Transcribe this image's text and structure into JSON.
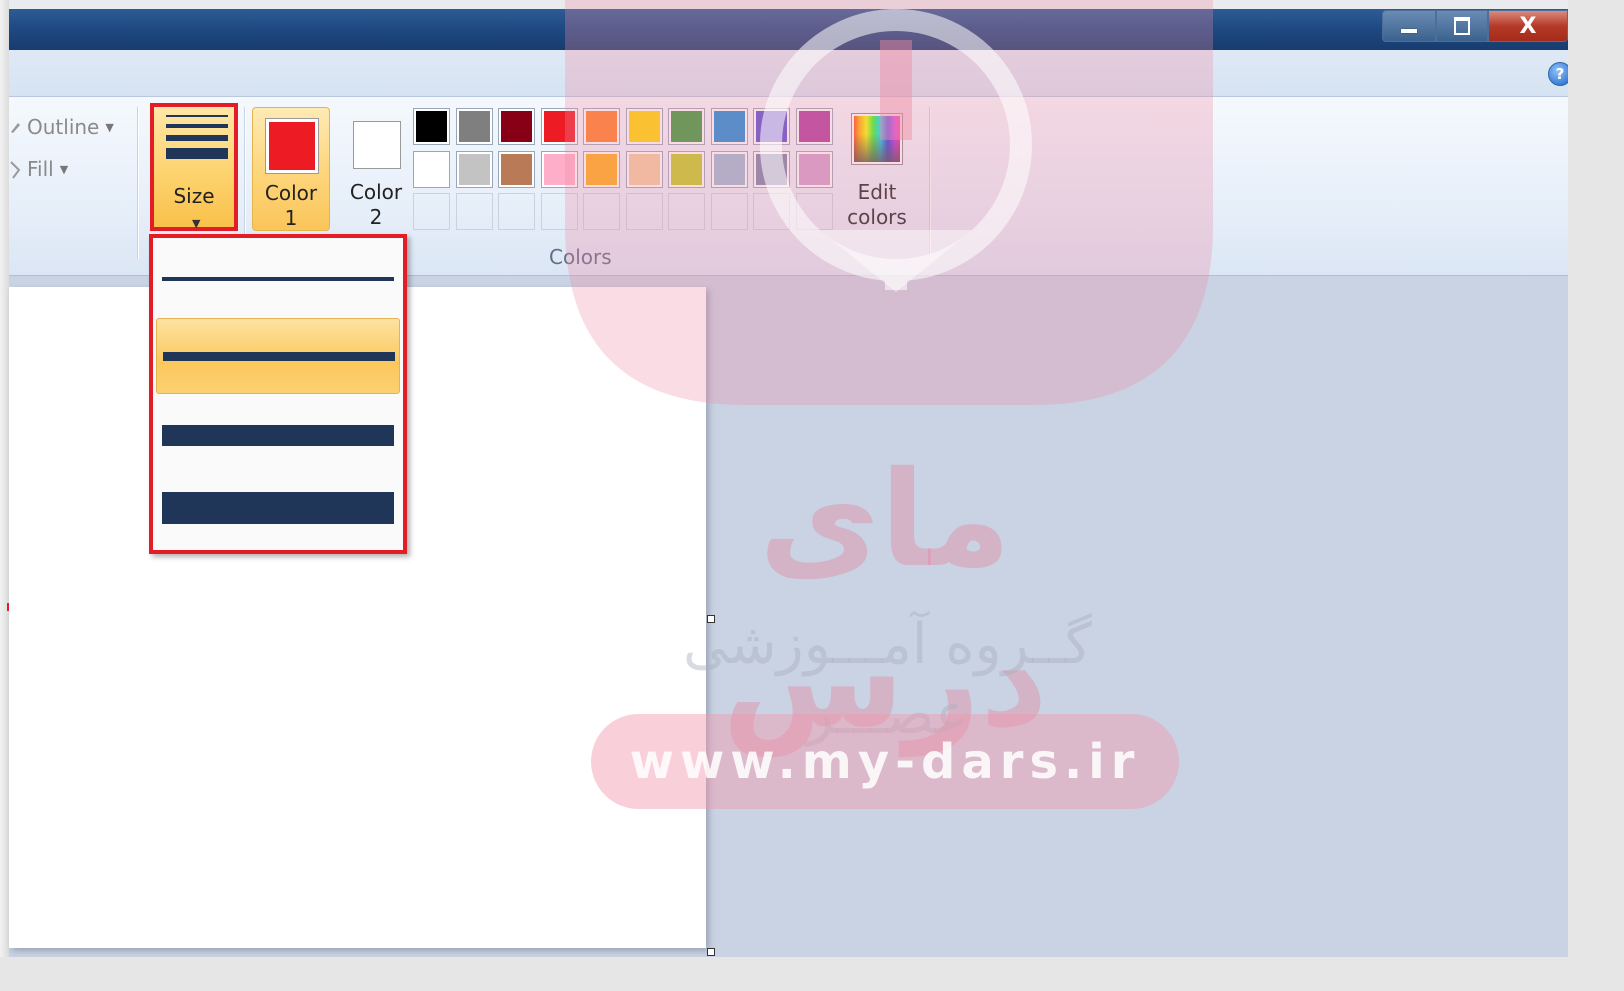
{
  "ribbon": {
    "shapes": {
      "outline_label": "Outline",
      "fill_label": "Fill"
    },
    "size_button_label": "Size",
    "color1": {
      "label_line1": "Color",
      "label_line2": "1",
      "color": "#ed1c24"
    },
    "color2": {
      "label_line1": "Color",
      "label_line2": "2",
      "color": "#ffffff"
    },
    "colors_group_label": "Colors",
    "palette_row1": [
      "#000000",
      "#7f7f7f",
      "#880015",
      "#ed1c24",
      "#ff7f27",
      "#ffd800",
      "#3c9b3c",
      "#1f8fd8",
      "#5b4fd1",
      "#b03ea0"
    ],
    "palette_row2": [
      "#ffffff",
      "#c3c3c3",
      "#b97a57",
      "#ffaec9",
      "#ffae1a",
      "#f2cda0",
      "#c0ce26",
      "#9cbad3",
      "#7b86aa",
      "#d0a0cc"
    ],
    "palette_row3_empty_count": 10,
    "edit_colors": {
      "label_line1": "Edit",
      "label_line2": "colors"
    }
  },
  "size_menu": {
    "options": [
      {
        "name": "1px"
      },
      {
        "name": "3px",
        "selected": true
      },
      {
        "name": "5px"
      },
      {
        "name": "8px"
      }
    ]
  },
  "window": {
    "minimize_glyph": "–",
    "close_glyph": "X",
    "help_glyph": "?"
  },
  "watermark": {
    "title": "مای درس",
    "subtitle": "گــروه آمـــوزشی عصـــر",
    "url": "www.my-dars.ir"
  }
}
